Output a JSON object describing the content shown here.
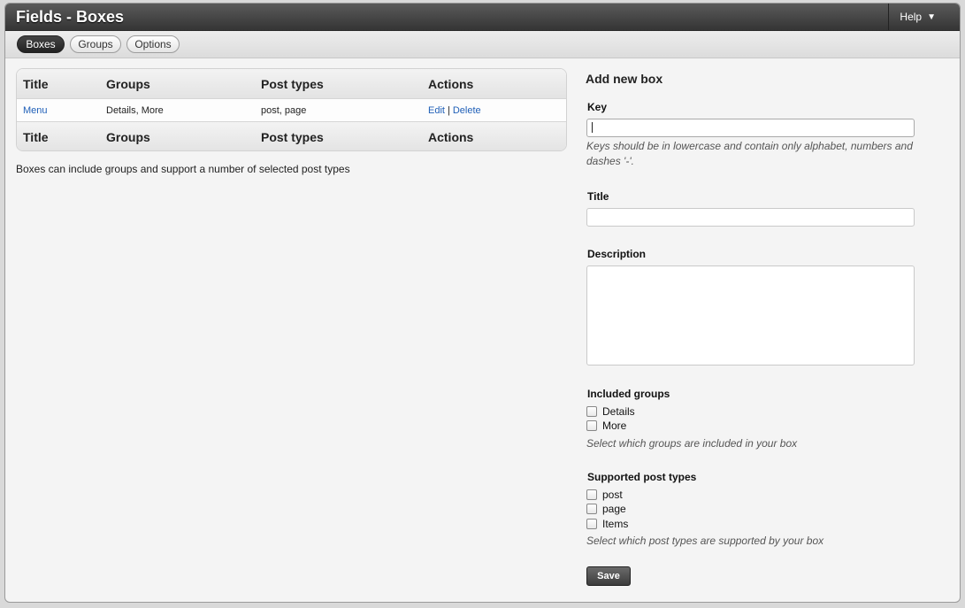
{
  "header": {
    "title": "Fields - Boxes",
    "help_label": "Help",
    "help_icon": "triangle-down"
  },
  "tabs": [
    {
      "label": "Boxes",
      "active": true
    },
    {
      "label": "Groups",
      "active": false
    },
    {
      "label": "Options",
      "active": false
    }
  ],
  "table": {
    "columns": [
      "Title",
      "Groups",
      "Post types",
      "Actions"
    ],
    "rows": [
      {
        "title": "Menu",
        "groups": "Details, More",
        "post_types": "post, page",
        "edit": "Edit",
        "separator": "|",
        "delete": "Delete"
      }
    ]
  },
  "help_text": "Boxes can include groups and support a number of selected post types",
  "form": {
    "heading": "Add new box",
    "key_label": "Key",
    "key_value": "",
    "key_hint": "Keys should be in lowercase and contain only alphabet, numbers and dashes '-'.",
    "title_label": "Title",
    "title_value": "",
    "description_label": "Description",
    "description_value": "",
    "groups_label": "Included groups",
    "groups": [
      {
        "label": "Details",
        "checked": false
      },
      {
        "label": "More",
        "checked": false
      }
    ],
    "groups_hint": "Select which groups are included in your box",
    "post_types_label": "Supported post types",
    "post_types": [
      {
        "label": "post",
        "checked": false
      },
      {
        "label": "page",
        "checked": false
      },
      {
        "label": "Items",
        "checked": false
      }
    ],
    "post_types_hint": "Select which post types are supported by your box",
    "save_label": "Save"
  },
  "colors": {
    "titlebar": "#353535",
    "link": "#2060b8",
    "active_tab": "#222222"
  }
}
